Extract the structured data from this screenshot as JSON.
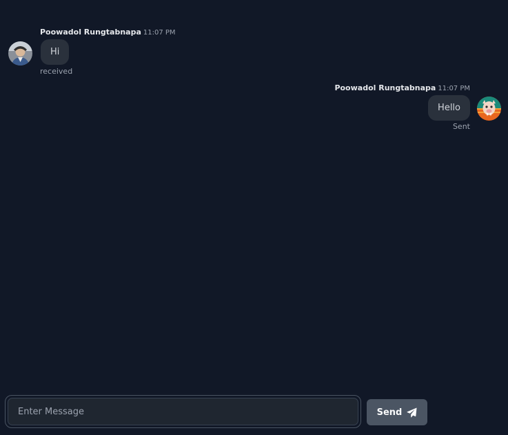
{
  "messages": [
    {
      "sender": "Poowadol Rungtabnapa",
      "time": "11:07 PM",
      "text": "Hi",
      "status": "received"
    },
    {
      "sender": "Poowadol Rungtabnapa",
      "time": "11:07 PM",
      "text": "Hello",
      "status": "Sent"
    }
  ],
  "composer": {
    "placeholder": "Enter Message",
    "value": "",
    "send_label": "Send",
    "send_icon": "paper-plane-icon"
  },
  "colors": {
    "background": "#111827",
    "bubble": "#2a313c",
    "send_button": "#4b5563"
  }
}
